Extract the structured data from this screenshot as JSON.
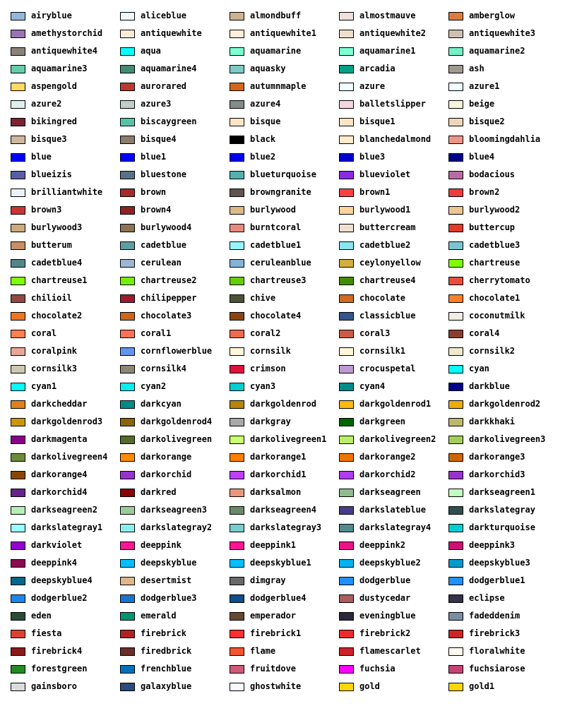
{
  "colors": [
    {
      "name": "airyblue",
      "hex": "#93b7dc"
    },
    {
      "name": "aliceblue",
      "hex": "#f0f8ff"
    },
    {
      "name": "almondbuff",
      "hex": "#cdb391"
    },
    {
      "name": "almostmauve",
      "hex": "#efe0dc"
    },
    {
      "name": "amberglow",
      "hex": "#de7a40"
    },
    {
      "name": "amethystorchid",
      "hex": "#9a73b5"
    },
    {
      "name": "antiquewhite",
      "hex": "#faebd7"
    },
    {
      "name": "antiquewhite1",
      "hex": "#ffefdb"
    },
    {
      "name": "antiquewhite2",
      "hex": "#eedfcc"
    },
    {
      "name": "antiquewhite3",
      "hex": "#cdc0b0"
    },
    {
      "name": "antiquewhite4",
      "hex": "#8b8378"
    },
    {
      "name": "aqua",
      "hex": "#00ffff"
    },
    {
      "name": "aquamarine",
      "hex": "#7fffd4"
    },
    {
      "name": "aquamarine1",
      "hex": "#7fffd4"
    },
    {
      "name": "aquamarine2",
      "hex": "#76eec6"
    },
    {
      "name": "aquamarine3",
      "hex": "#66cdaa"
    },
    {
      "name": "aquamarine4",
      "hex": "#458b74"
    },
    {
      "name": "aquasky",
      "hex": "#7fc9c9"
    },
    {
      "name": "arcadia",
      "hex": "#00a187"
    },
    {
      "name": "ash",
      "hex": "#a09991"
    },
    {
      "name": "aspengold",
      "hex": "#ffd961"
    },
    {
      "name": "aurorared",
      "hex": "#b93a32"
    },
    {
      "name": "autumnmaple",
      "hex": "#d3661b"
    },
    {
      "name": "azure",
      "hex": "#f0ffff"
    },
    {
      "name": "azure1",
      "hex": "#f0ffff"
    },
    {
      "name": "azure2",
      "hex": "#e0eeee"
    },
    {
      "name": "azure3",
      "hex": "#c1cdcd"
    },
    {
      "name": "azure4",
      "hex": "#838b8b"
    },
    {
      "name": "balletslipper",
      "hex": "#f5d5e1"
    },
    {
      "name": "beige",
      "hex": "#f5f5dc"
    },
    {
      "name": "bikingred",
      "hex": "#7c2230"
    },
    {
      "name": "biscaygreen",
      "hex": "#55c4a6"
    },
    {
      "name": "bisque",
      "hex": "#ffe4c4"
    },
    {
      "name": "bisque1",
      "hex": "#ffe4c4"
    },
    {
      "name": "bisque2",
      "hex": "#eed5b7"
    },
    {
      "name": "bisque3",
      "hex": "#cdb79e"
    },
    {
      "name": "bisque4",
      "hex": "#8b7d6b"
    },
    {
      "name": "black",
      "hex": "#000000"
    },
    {
      "name": "blanchedalmond",
      "hex": "#ffebcd"
    },
    {
      "name": "bloomingdahlia",
      "hex": "#eb9687"
    },
    {
      "name": "blue",
      "hex": "#0000ff"
    },
    {
      "name": "blue1",
      "hex": "#0000ff"
    },
    {
      "name": "blue2",
      "hex": "#0000ee"
    },
    {
      "name": "blue3",
      "hex": "#0000cd"
    },
    {
      "name": "blue4",
      "hex": "#00008b"
    },
    {
      "name": "blueizis",
      "hex": "#5b5ea6"
    },
    {
      "name": "bluestone",
      "hex": "#577284"
    },
    {
      "name": "blueturquoise",
      "hex": "#53b0ae"
    },
    {
      "name": "blueviolet",
      "hex": "#8a2be2"
    },
    {
      "name": "bodacious",
      "hex": "#b76ba3"
    },
    {
      "name": "brilliantwhite",
      "hex": "#edf1fe"
    },
    {
      "name": "brown",
      "hex": "#a52a2a"
    },
    {
      "name": "browngranite",
      "hex": "#615550"
    },
    {
      "name": "brown1",
      "hex": "#ff4040"
    },
    {
      "name": "brown2",
      "hex": "#ee3b3b"
    },
    {
      "name": "brown3",
      "hex": "#cd3333"
    },
    {
      "name": "brown4",
      "hex": "#8b2323"
    },
    {
      "name": "burlywood",
      "hex": "#deb887"
    },
    {
      "name": "burlywood1",
      "hex": "#ffd39b"
    },
    {
      "name": "burlywood2",
      "hex": "#eec591"
    },
    {
      "name": "burlywood3",
      "hex": "#cdaa7d"
    },
    {
      "name": "burlywood4",
      "hex": "#8b7355"
    },
    {
      "name": "burntcoral",
      "hex": "#e9897e"
    },
    {
      "name": "buttercream",
      "hex": "#efe1ce"
    },
    {
      "name": "buttercup",
      "hex": "#e1392a"
    },
    {
      "name": "butterum",
      "hex": "#c68f65"
    },
    {
      "name": "cadetblue",
      "hex": "#5f9ea0"
    },
    {
      "name": "cadetblue1",
      "hex": "#98f5ff"
    },
    {
      "name": "cadetblue2",
      "hex": "#8ee5ee"
    },
    {
      "name": "cadetblue3",
      "hex": "#7ac5cd"
    },
    {
      "name": "cadetblue4",
      "hex": "#53868b"
    },
    {
      "name": "cerulean",
      "hex": "#9bb7d4"
    },
    {
      "name": "ceruleanblue",
      "hex": "#87b1d7"
    },
    {
      "name": "ceylonyellow",
      "hex": "#d4ae40"
    },
    {
      "name": "chartreuse",
      "hex": "#7fff00"
    },
    {
      "name": "chartreuse1",
      "hex": "#7fff00"
    },
    {
      "name": "chartreuse2",
      "hex": "#76ee00"
    },
    {
      "name": "chartreuse3",
      "hex": "#66cd00"
    },
    {
      "name": "chartreuse4",
      "hex": "#458b00"
    },
    {
      "name": "cherrytomato",
      "hex": "#e94b3c"
    },
    {
      "name": "chilioil",
      "hex": "#944743"
    },
    {
      "name": "chilipepper",
      "hex": "#9b1b30"
    },
    {
      "name": "chive",
      "hex": "#4b5335"
    },
    {
      "name": "chocolate",
      "hex": "#d2691e"
    },
    {
      "name": "chocolate1",
      "hex": "#ff7f24"
    },
    {
      "name": "chocolate2",
      "hex": "#ee7621"
    },
    {
      "name": "chocolate3",
      "hex": "#cd661d"
    },
    {
      "name": "chocolate4",
      "hex": "#8b4513"
    },
    {
      "name": "classicblue",
      "hex": "#34568b"
    },
    {
      "name": "coconutmilk",
      "hex": "#f0ede5"
    },
    {
      "name": "coral",
      "hex": "#ff7f50"
    },
    {
      "name": "coral1",
      "hex": "#ff7256"
    },
    {
      "name": "coral2",
      "hex": "#ee6a50"
    },
    {
      "name": "coral3",
      "hex": "#cd5b45"
    },
    {
      "name": "coral4",
      "hex": "#8b3e2f"
    },
    {
      "name": "coralpink",
      "hex": "#e8a798"
    },
    {
      "name": "cornflowerblue",
      "hex": "#6495ed"
    },
    {
      "name": "cornsilk",
      "hex": "#fff8dc"
    },
    {
      "name": "cornsilk1",
      "hex": "#fff8dc"
    },
    {
      "name": "cornsilk2",
      "hex": "#eee8cd"
    },
    {
      "name": "cornsilk3",
      "hex": "#cdc8b1"
    },
    {
      "name": "cornsilk4",
      "hex": "#8b8878"
    },
    {
      "name": "crimson",
      "hex": "#dc143c"
    },
    {
      "name": "crocuspetal",
      "hex": "#be9cd3"
    },
    {
      "name": "cyan",
      "hex": "#00ffff"
    },
    {
      "name": "cyan1",
      "hex": "#00ffff"
    },
    {
      "name": "cyan2",
      "hex": "#00eeee"
    },
    {
      "name": "cyan3",
      "hex": "#00cdcd"
    },
    {
      "name": "cyan4",
      "hex": "#008b8b"
    },
    {
      "name": "darkblue",
      "hex": "#00008b"
    },
    {
      "name": "darkcheddar",
      "hex": "#e08119"
    },
    {
      "name": "darkcyan",
      "hex": "#008b8b"
    },
    {
      "name": "darkgoldenrod",
      "hex": "#b8860b"
    },
    {
      "name": "darkgoldenrod1",
      "hex": "#ffb90f"
    },
    {
      "name": "darkgoldenrod2",
      "hex": "#eead0e"
    },
    {
      "name": "darkgoldenrod3",
      "hex": "#cd950c"
    },
    {
      "name": "darkgoldenrod4",
      "hex": "#8b6508"
    },
    {
      "name": "darkgray",
      "hex": "#a9a9a9"
    },
    {
      "name": "darkgreen",
      "hex": "#006400"
    },
    {
      "name": "darkkhaki",
      "hex": "#bdb76b"
    },
    {
      "name": "darkmagenta",
      "hex": "#8b008b"
    },
    {
      "name": "darkolivegreen",
      "hex": "#556b2f"
    },
    {
      "name": "darkolivegreen1",
      "hex": "#caff70"
    },
    {
      "name": "darkolivegreen2",
      "hex": "#bcee68"
    },
    {
      "name": "darkolivegreen3",
      "hex": "#a2cd5a"
    },
    {
      "name": "darkolivegreen4",
      "hex": "#6e8b3d"
    },
    {
      "name": "darkorange",
      "hex": "#ff8c00"
    },
    {
      "name": "darkorange1",
      "hex": "#ff7f00"
    },
    {
      "name": "darkorange2",
      "hex": "#ee7600"
    },
    {
      "name": "darkorange3",
      "hex": "#cd6600"
    },
    {
      "name": "darkorange4",
      "hex": "#8b4500"
    },
    {
      "name": "darkorchid",
      "hex": "#9932cc"
    },
    {
      "name": "darkorchid1",
      "hex": "#bf3eff"
    },
    {
      "name": "darkorchid2",
      "hex": "#b23aee"
    },
    {
      "name": "darkorchid3",
      "hex": "#9a32cd"
    },
    {
      "name": "darkorchid4",
      "hex": "#68228b"
    },
    {
      "name": "darkred",
      "hex": "#8b0000"
    },
    {
      "name": "darksalmon",
      "hex": "#e9967a"
    },
    {
      "name": "darkseagreen",
      "hex": "#8fbc8f"
    },
    {
      "name": "darkseagreen1",
      "hex": "#c1ffc1"
    },
    {
      "name": "darkseagreen2",
      "hex": "#b4eeb4"
    },
    {
      "name": "darkseagreen3",
      "hex": "#9bcd9b"
    },
    {
      "name": "darkseagreen4",
      "hex": "#698b69"
    },
    {
      "name": "darkslateblue",
      "hex": "#483d8b"
    },
    {
      "name": "darkslategray",
      "hex": "#2f4f4f"
    },
    {
      "name": "darkslategray1",
      "hex": "#97ffff"
    },
    {
      "name": "darkslategray2",
      "hex": "#8deeee"
    },
    {
      "name": "darkslategray3",
      "hex": "#79cdcd"
    },
    {
      "name": "darkslategray4",
      "hex": "#528b8b"
    },
    {
      "name": "darkturquoise",
      "hex": "#00ced1"
    },
    {
      "name": "darkviolet",
      "hex": "#9400d3"
    },
    {
      "name": "deeppink",
      "hex": "#ff1493"
    },
    {
      "name": "deeppink1",
      "hex": "#ff1493"
    },
    {
      "name": "deeppink2",
      "hex": "#ee1289"
    },
    {
      "name": "deeppink3",
      "hex": "#cd1076"
    },
    {
      "name": "deeppink4",
      "hex": "#8b0a50"
    },
    {
      "name": "deepskyblue",
      "hex": "#00bfff"
    },
    {
      "name": "deepskyblue1",
      "hex": "#00bfff"
    },
    {
      "name": "deepskyblue2",
      "hex": "#00b2ee"
    },
    {
      "name": "deepskyblue3",
      "hex": "#009acd"
    },
    {
      "name": "deepskyblue4",
      "hex": "#00688b"
    },
    {
      "name": "desertmist",
      "hex": "#e0b589"
    },
    {
      "name": "dimgray",
      "hex": "#696969"
    },
    {
      "name": "dodgerblue",
      "hex": "#1e90ff"
    },
    {
      "name": "dodgerblue1",
      "hex": "#1e90ff"
    },
    {
      "name": "dodgerblue2",
      "hex": "#1c86ee"
    },
    {
      "name": "dodgerblue3",
      "hex": "#1874cd"
    },
    {
      "name": "dodgerblue4",
      "hex": "#104e8b"
    },
    {
      "name": "dustycedar",
      "hex": "#ad5d5d"
    },
    {
      "name": "eclipse",
      "hex": "#343148"
    },
    {
      "name": "eden",
      "hex": "#264e36"
    },
    {
      "name": "emerald",
      "hex": "#009473"
    },
    {
      "name": "emperador",
      "hex": "#684832"
    },
    {
      "name": "eveningblue",
      "hex": "#2a293e"
    },
    {
      "name": "fadeddenim",
      "hex": "#798ea4"
    },
    {
      "name": "fiesta",
      "hex": "#dd4132"
    },
    {
      "name": "firebrick",
      "hex": "#b22222"
    },
    {
      "name": "firebrick1",
      "hex": "#ff3030"
    },
    {
      "name": "firebrick2",
      "hex": "#ee2c2c"
    },
    {
      "name": "firebrick3",
      "hex": "#cd2626"
    },
    {
      "name": "firebrick4",
      "hex": "#8b1a1a"
    },
    {
      "name": "firedbrick",
      "hex": "#6a2e2a"
    },
    {
      "name": "flame",
      "hex": "#f2552c"
    },
    {
      "name": "flamescarlet",
      "hex": "#cd212a"
    },
    {
      "name": "floralwhite",
      "hex": "#fffaf0"
    },
    {
      "name": "forestgreen",
      "hex": "#228b22"
    },
    {
      "name": "frenchblue",
      "hex": "#0072b5"
    },
    {
      "name": "fruitdove",
      "hex": "#ce5b78"
    },
    {
      "name": "fuchsia",
      "hex": "#ff00ff"
    },
    {
      "name": "fuchsiarose",
      "hex": "#c74375"
    },
    {
      "name": "gainsboro",
      "hex": "#dcdcdc"
    },
    {
      "name": "galaxyblue",
      "hex": "#2a4b7c"
    },
    {
      "name": "ghostwhite",
      "hex": "#f8f8ff"
    },
    {
      "name": "gold",
      "hex": "#ffd700"
    },
    {
      "name": "gold1",
      "hex": "#ffd700"
    }
  ]
}
